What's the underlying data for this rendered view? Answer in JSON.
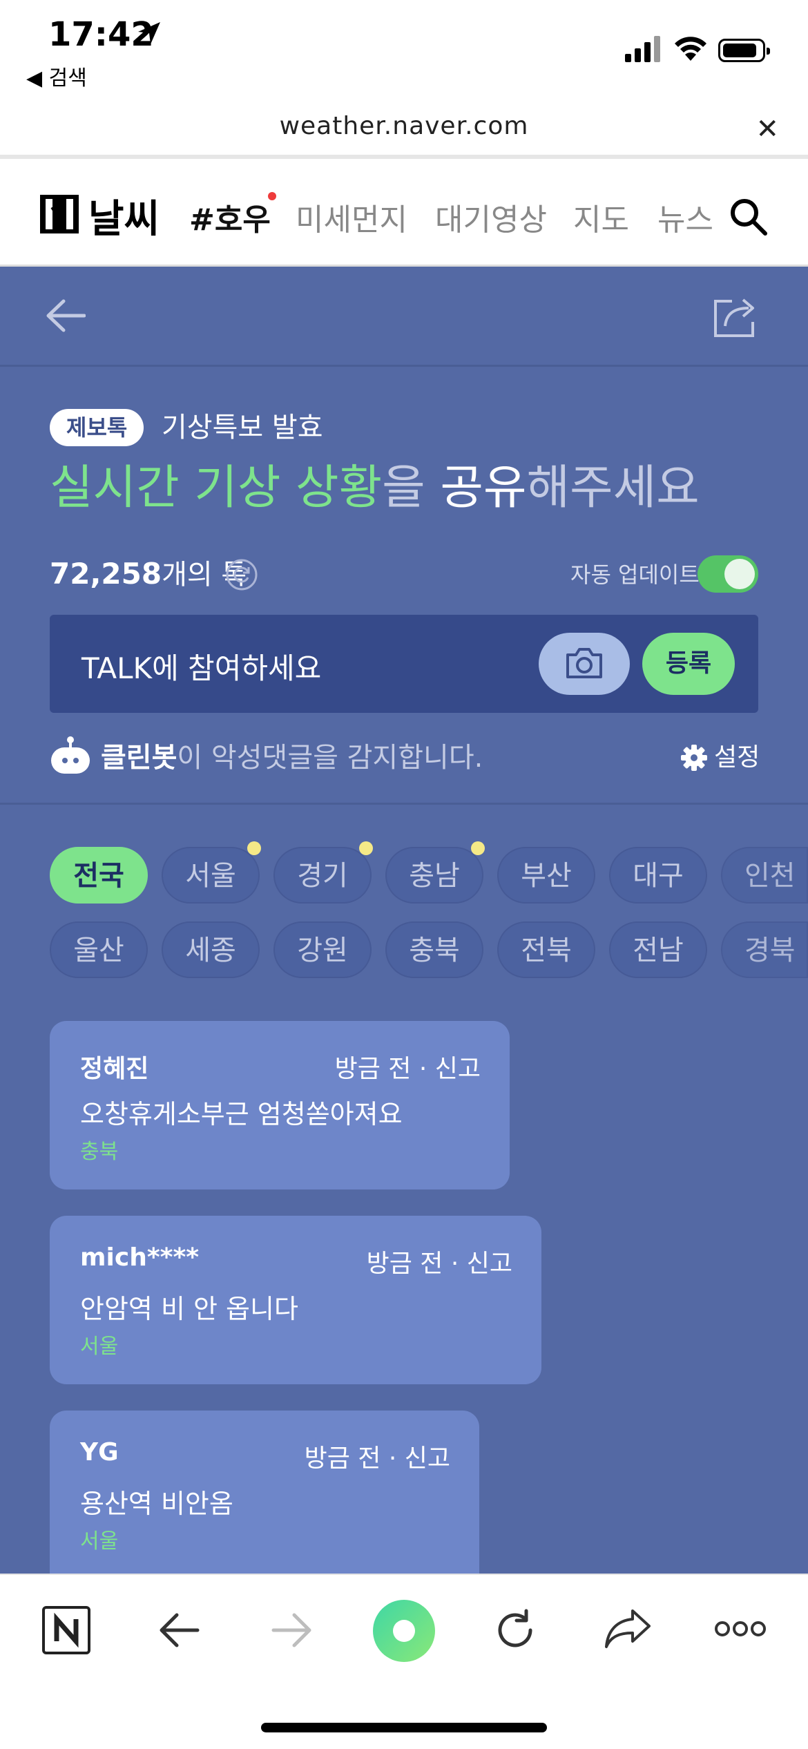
{
  "status_bar": {
    "time": "17:42",
    "back_app": "◀ 검색"
  },
  "browser": {
    "url": "weather.naver.com"
  },
  "site_header": {
    "logo": "날씨",
    "nav": [
      {
        "label": "#호우"
      },
      {
        "label": "미세먼지"
      },
      {
        "label": "대기영상"
      },
      {
        "label": "지도"
      },
      {
        "label": "뉴스"
      }
    ]
  },
  "hero": {
    "badge": "제보톡",
    "alert": "기상특보 발효",
    "headline": {
      "part1": "실시간 기상 상황",
      "part2": "을 ",
      "part3": "공유",
      "part4": "해주세요"
    }
  },
  "talk": {
    "count": "72,258",
    "count_suffix": "개의 톡",
    "auto_update_label": "자동 업데이트",
    "auto_update_on": true,
    "placeholder": "TALK에 참여하세요",
    "register_label": "등록"
  },
  "cleanbot": {
    "name": "클린봇",
    "message": "이 악성댓글을 감지합니다.",
    "settings_label": "설정"
  },
  "regions": {
    "row1": [
      "전국",
      "서울",
      "경기",
      "충남",
      "부산",
      "대구",
      "인천"
    ],
    "row2": [
      "울산",
      "세종",
      "강원",
      "충북",
      "전북",
      "전남",
      "경북"
    ]
  },
  "posts": [
    {
      "user": "정혜진",
      "time": "방금 전",
      "report": "신고",
      "text": "오창휴게소부근 엄청쏟아져요",
      "region": "충북"
    },
    {
      "user": "mich****",
      "time": "방금 전",
      "report": "신고",
      "text": "안암역 비 안 옵니다",
      "region": "서울"
    },
    {
      "user": "YG",
      "time": "방금 전",
      "report": "신고",
      "text": "용산역 비안옴",
      "region": "서울"
    }
  ],
  "colors": {
    "main_bg": "#5469a4",
    "accent_green": "#7ee38c",
    "card_bg": "#6e86c9"
  }
}
